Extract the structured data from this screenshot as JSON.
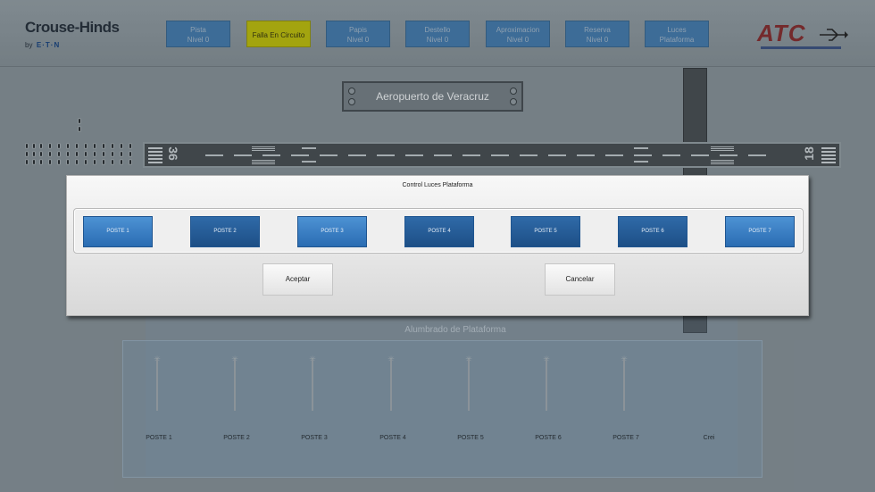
{
  "brand": {
    "name": "Crouse-Hinds",
    "by": "by",
    "maker": "E·T·N"
  },
  "topbar": {
    "buttons": [
      {
        "line1": "Pista",
        "line2": "Nivel 0"
      },
      {
        "line1": "Falla En Circuito",
        "line2": ""
      },
      {
        "line1": "Papis",
        "line2": "Nivel 0"
      },
      {
        "line1": "Destello",
        "line2": "Nivel 0"
      },
      {
        "line1": "Aproximacion",
        "line2": "Nivel 0"
      },
      {
        "line1": "Reserva",
        "line2": "Nivel 0"
      },
      {
        "line1": "Luces",
        "line2": "Plataforma"
      }
    ],
    "warn_color": "#b8b800",
    "accent_color": "#3b73a6"
  },
  "logo": {
    "text": "ATC"
  },
  "airport": {
    "name": "Aeropuerto de Veracruz"
  },
  "runway": {
    "left_number": "36",
    "right_number": "18"
  },
  "platform": {
    "title": "Alumbrado de Plataforma",
    "poles": [
      "POSTE 1",
      "POSTE 2",
      "POSTE 3",
      "POSTE 4",
      "POSTE 5",
      "POSTE 6",
      "POSTE 7",
      "Crei"
    ]
  },
  "dialog": {
    "title": "Control Luces Plataforma",
    "postes": [
      "POSTE 1",
      "POSTE 2",
      "POSTE 3",
      "POSTE 4",
      "POSTE 5",
      "POSTE 6",
      "POSTE 7"
    ],
    "accept_label": "Aceptar",
    "cancel_label": "Cancelar"
  }
}
